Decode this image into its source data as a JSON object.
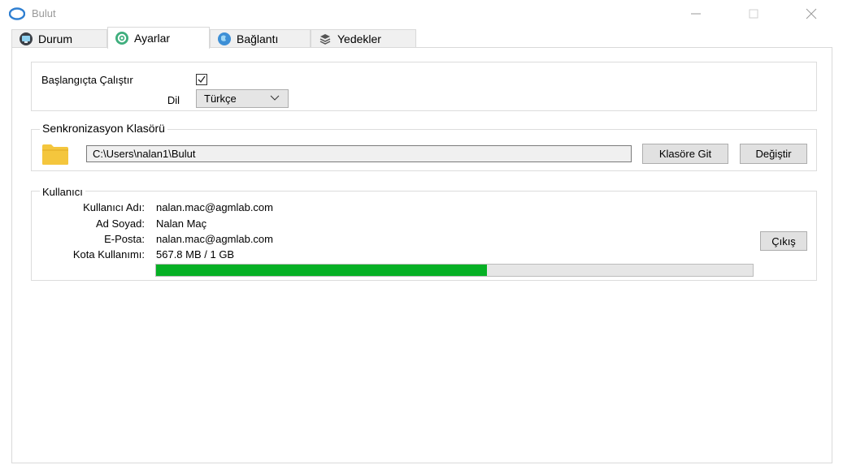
{
  "window": {
    "title": "Bulut"
  },
  "tabs": [
    {
      "label": "Durum",
      "icon": "monitor-icon",
      "active": false
    },
    {
      "label": "Ayarlar",
      "icon": "gear-icon",
      "active": true
    },
    {
      "label": "Bağlantı",
      "icon": "globe-icon",
      "active": false
    },
    {
      "label": "Yedekler",
      "icon": "stack-icon",
      "active": false
    }
  ],
  "general": {
    "startup_label": "Başlangıçta Çalıştır",
    "startup_checked": true,
    "language_label": "Dil",
    "language_value": "Türkçe"
  },
  "sync": {
    "legend": "Senkronizasyon Klasörü",
    "folder_path": "C:\\Users\\nalan1\\Bulut",
    "go_button": "Klasöre Git",
    "change_button": "Değiştir"
  },
  "user": {
    "legend": "Kullanıcı",
    "username_label": "Kullanıcı Adı:",
    "username_value": "nalan.mac@agmlab.com",
    "fullname_label": "Ad Soyad:",
    "fullname_value": "Nalan Maç",
    "email_label": "E-Posta:",
    "email_value": "nalan.mac@agmlab.com",
    "quota_label": "Kota Kullanımı:",
    "quota_value": "567.8 MB / 1 GB",
    "quota_fraction": 0.5545,
    "logout_button": "Çıkış"
  },
  "colors": {
    "progress": "#06b025",
    "folder": "#f4c63d",
    "accent": "#2f7fd1"
  }
}
